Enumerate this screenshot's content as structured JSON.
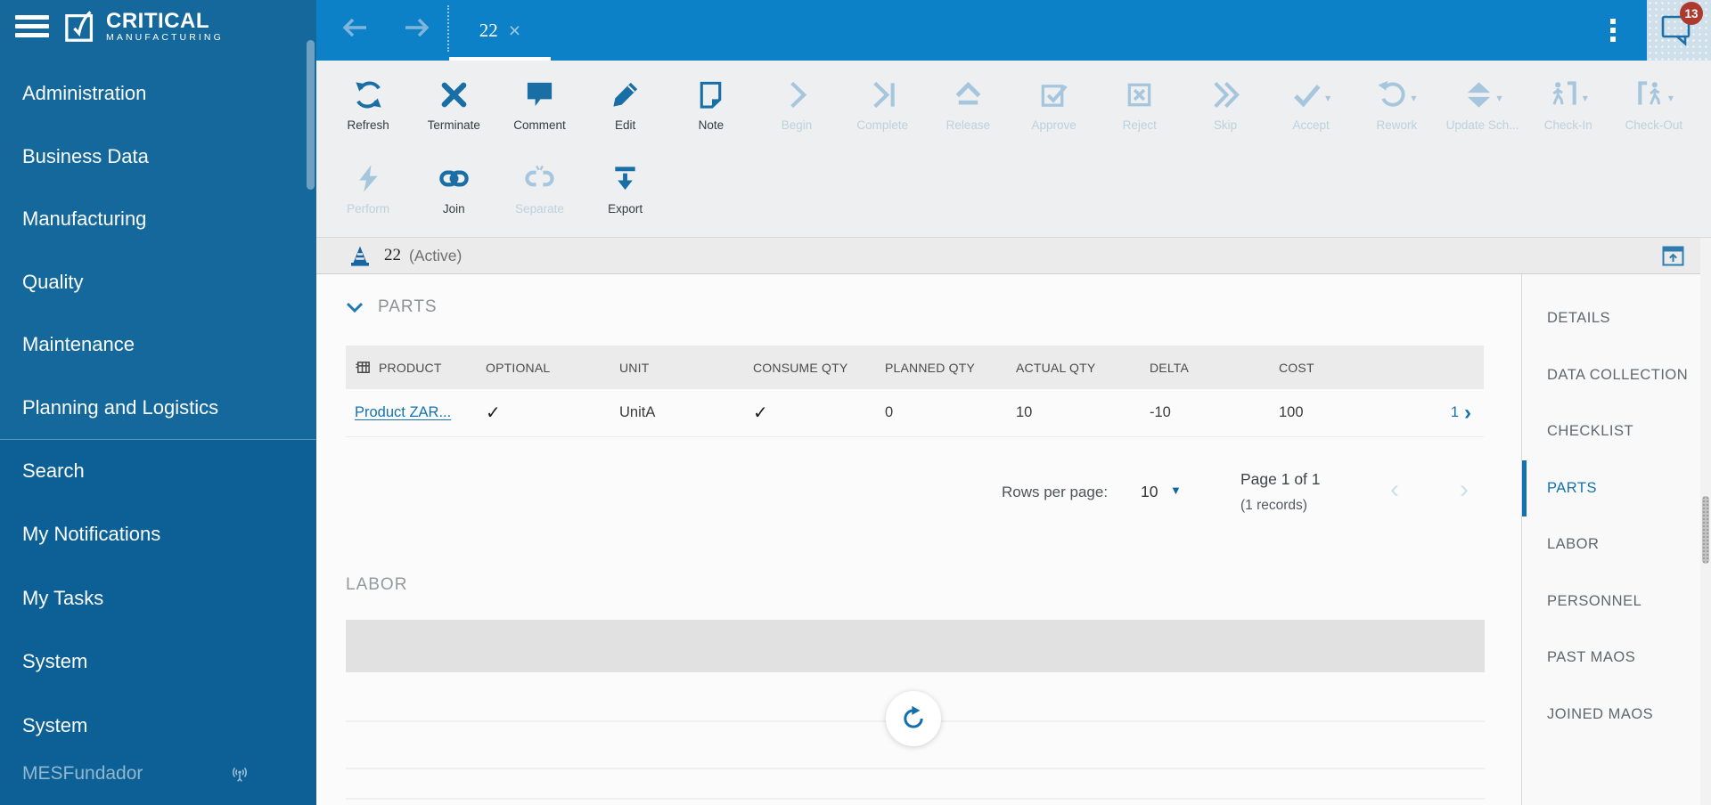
{
  "brand": {
    "title": "CRITICAL",
    "subtitle": "MANUFACTURING"
  },
  "topbar": {
    "tab_label": "22",
    "notification_count": "13"
  },
  "sidebar": {
    "primary": [
      {
        "label": "Administration",
        "name": "sidebar-item-administration"
      },
      {
        "label": "Business Data",
        "name": "sidebar-item-business-data"
      },
      {
        "label": "Manufacturing",
        "name": "sidebar-item-manufacturing"
      },
      {
        "label": "Quality",
        "name": "sidebar-item-quality"
      },
      {
        "label": "Maintenance",
        "name": "sidebar-item-maintenance"
      },
      {
        "label": "Planning and Logistics",
        "name": "sidebar-item-planning-and-logistics"
      }
    ],
    "secondary": [
      {
        "label": "Search",
        "name": "sidebar-item-search"
      },
      {
        "label": "My Notifications",
        "name": "sidebar-item-my-notifications"
      },
      {
        "label": "My Tasks",
        "name": "sidebar-item-my-tasks"
      },
      {
        "label": "System",
        "name": "sidebar-item-system-1"
      },
      {
        "label": "System",
        "name": "sidebar-item-system-2"
      }
    ],
    "footer_label": "MESFundador"
  },
  "toolbar": {
    "row1": [
      {
        "label": "Refresh",
        "icon": "refresh-icon",
        "name": "toolbar-button-refresh",
        "enabled": true
      },
      {
        "label": "Terminate",
        "icon": "terminate-icon",
        "name": "toolbar-button-terminate",
        "enabled": true
      },
      {
        "label": "Comment",
        "icon": "comment-icon",
        "name": "toolbar-button-comment",
        "enabled": true
      },
      {
        "label": "Edit",
        "icon": "edit-icon",
        "name": "toolbar-button-edit",
        "enabled": true
      },
      {
        "label": "Note",
        "icon": "note-icon",
        "name": "toolbar-button-note",
        "enabled": true
      },
      {
        "label": "Begin",
        "icon": "begin-icon",
        "name": "toolbar-button-begin",
        "enabled": false
      },
      {
        "label": "Complete",
        "icon": "complete-icon",
        "name": "toolbar-button-complete",
        "enabled": false
      },
      {
        "label": "Release",
        "icon": "release-icon",
        "name": "toolbar-button-release",
        "enabled": false
      },
      {
        "label": "Approve",
        "icon": "approve-icon",
        "name": "toolbar-button-approve",
        "enabled": false
      },
      {
        "label": "Reject",
        "icon": "reject-icon",
        "name": "toolbar-button-reject",
        "enabled": false
      },
      {
        "label": "Skip",
        "icon": "skip-icon",
        "name": "toolbar-button-skip",
        "enabled": false
      },
      {
        "label": "Accept",
        "icon": "accept-icon",
        "name": "toolbar-button-accept",
        "enabled": false,
        "dropdown": true
      },
      {
        "label": "Rework",
        "icon": "rework-icon",
        "name": "toolbar-button-rework",
        "enabled": false,
        "dropdown": true
      },
      {
        "label": "Update Sch...",
        "icon": "update-schedule-icon",
        "name": "toolbar-button-update-schedule",
        "enabled": false,
        "dropdown": true
      },
      {
        "label": "Check-In",
        "icon": "check-in-icon",
        "name": "toolbar-button-check-in",
        "enabled": false,
        "dropdown": true
      },
      {
        "label": "Check-Out",
        "icon": "check-out-icon",
        "name": "toolbar-button-check-out",
        "enabled": false,
        "dropdown": true
      }
    ],
    "row2": [
      {
        "label": "Perform",
        "icon": "perform-icon",
        "name": "toolbar-button-perform",
        "enabled": false
      },
      {
        "label": "Join",
        "icon": "join-icon",
        "name": "toolbar-button-join",
        "enabled": true
      },
      {
        "label": "Separate",
        "icon": "separate-icon",
        "name": "toolbar-button-separate",
        "enabled": false
      },
      {
        "label": "Export",
        "icon": "export-icon",
        "name": "toolbar-button-export",
        "enabled": true
      }
    ]
  },
  "statusbar": {
    "title": "22",
    "status": "(Active)"
  },
  "parts": {
    "title": "PARTS",
    "columns": [
      "PRODUCT",
      "OPTIONAL",
      "UNIT",
      "CONSUME QTY",
      "PLANNED QTY",
      "ACTUAL QTY",
      "DELTA",
      "COST"
    ],
    "row": {
      "product": "Product ZAR...",
      "optional": true,
      "unit": "UnitA",
      "consume_qty": true,
      "planned_qty": "0",
      "actual_qty": "10",
      "delta": "-10",
      "cost": "100",
      "pager": "1"
    },
    "pagination": {
      "rows_per_page_label": "Rows per page:",
      "rows_per_page": "10",
      "page": "Page 1 of 1",
      "records": "(1 records)"
    }
  },
  "labor": {
    "title": "LABOR"
  },
  "right_panel": [
    {
      "label": "DETAILS",
      "name": "tab-details"
    },
    {
      "label": "DATA COLLECTION",
      "name": "tab-data-collection"
    },
    {
      "label": "CHECKLIST",
      "name": "tab-checklist"
    },
    {
      "label": "PARTS",
      "name": "tab-parts",
      "active": true
    },
    {
      "label": "LABOR",
      "name": "tab-labor"
    },
    {
      "label": "PERSONNEL",
      "name": "tab-personnel"
    },
    {
      "label": "PAST MAOS",
      "name": "tab-past-maos"
    },
    {
      "label": "JOINED MAOS",
      "name": "tab-joined-maos"
    }
  ],
  "colors": {
    "topbar_blue": "#0d81c7",
    "sidebar_blue": "#15689c",
    "accent_blue": "#1a6ea6",
    "link_blue": "#1472ae",
    "badge_red": "#ae392e",
    "disabled_blue": "#a6c6dd"
  }
}
